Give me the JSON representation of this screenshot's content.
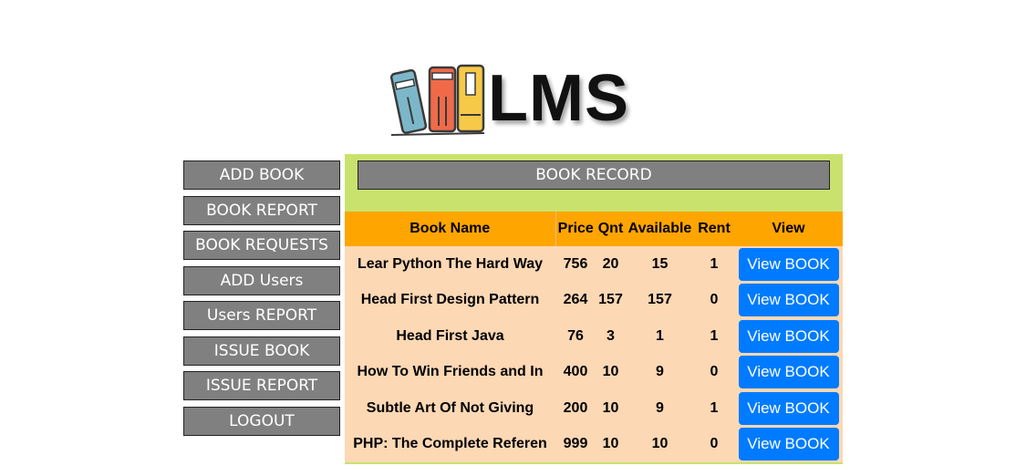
{
  "logo": {
    "text": "LMS"
  },
  "sidebar": {
    "items": [
      {
        "label": "ADD BOOK"
      },
      {
        "label": "BOOK REPORT"
      },
      {
        "label": "BOOK REQUESTS"
      },
      {
        "label": "ADD Users"
      },
      {
        "label": "Users REPORT"
      },
      {
        "label": "ISSUE BOOK"
      },
      {
        "label": "ISSUE REPORT"
      },
      {
        "label": "LOGOUT"
      }
    ]
  },
  "main": {
    "title": "BOOK RECORD",
    "columns": [
      "Book Name",
      "Price",
      "Qnt",
      "Available",
      "Rent",
      "View"
    ],
    "rows": [
      {
        "name": "Lear Python The Hard Way",
        "price": "756",
        "qnt": "20",
        "available": "15",
        "rent": "1",
        "action": "View BOOK"
      },
      {
        "name": "Head First Design Pattern",
        "price": "264",
        "qnt": "157",
        "available": "157",
        "rent": "0",
        "action": "View BOOK"
      },
      {
        "name": "Head First Java",
        "price": "76",
        "qnt": "3",
        "available": "1",
        "rent": "1",
        "action": "View BOOK"
      },
      {
        "name": "How To Win Friends and In",
        "price": "400",
        "qnt": "10",
        "available": "9",
        "rent": "0",
        "action": "View BOOK"
      },
      {
        "name": "Subtle Art Of Not Giving",
        "price": "200",
        "qnt": "10",
        "available": "9",
        "rent": "1",
        "action": "View BOOK"
      },
      {
        "name": "PHP: The Complete Referen",
        "price": "999",
        "qnt": "10",
        "available": "10",
        "rent": "0",
        "action": "View BOOK"
      }
    ]
  },
  "colors": {
    "panel_bg": "#c9e26e",
    "header_bg": "#ffa500",
    "row_bg": "#fcd8b4",
    "button_blue": "#007bff",
    "sidebar_button": "#808080"
  }
}
